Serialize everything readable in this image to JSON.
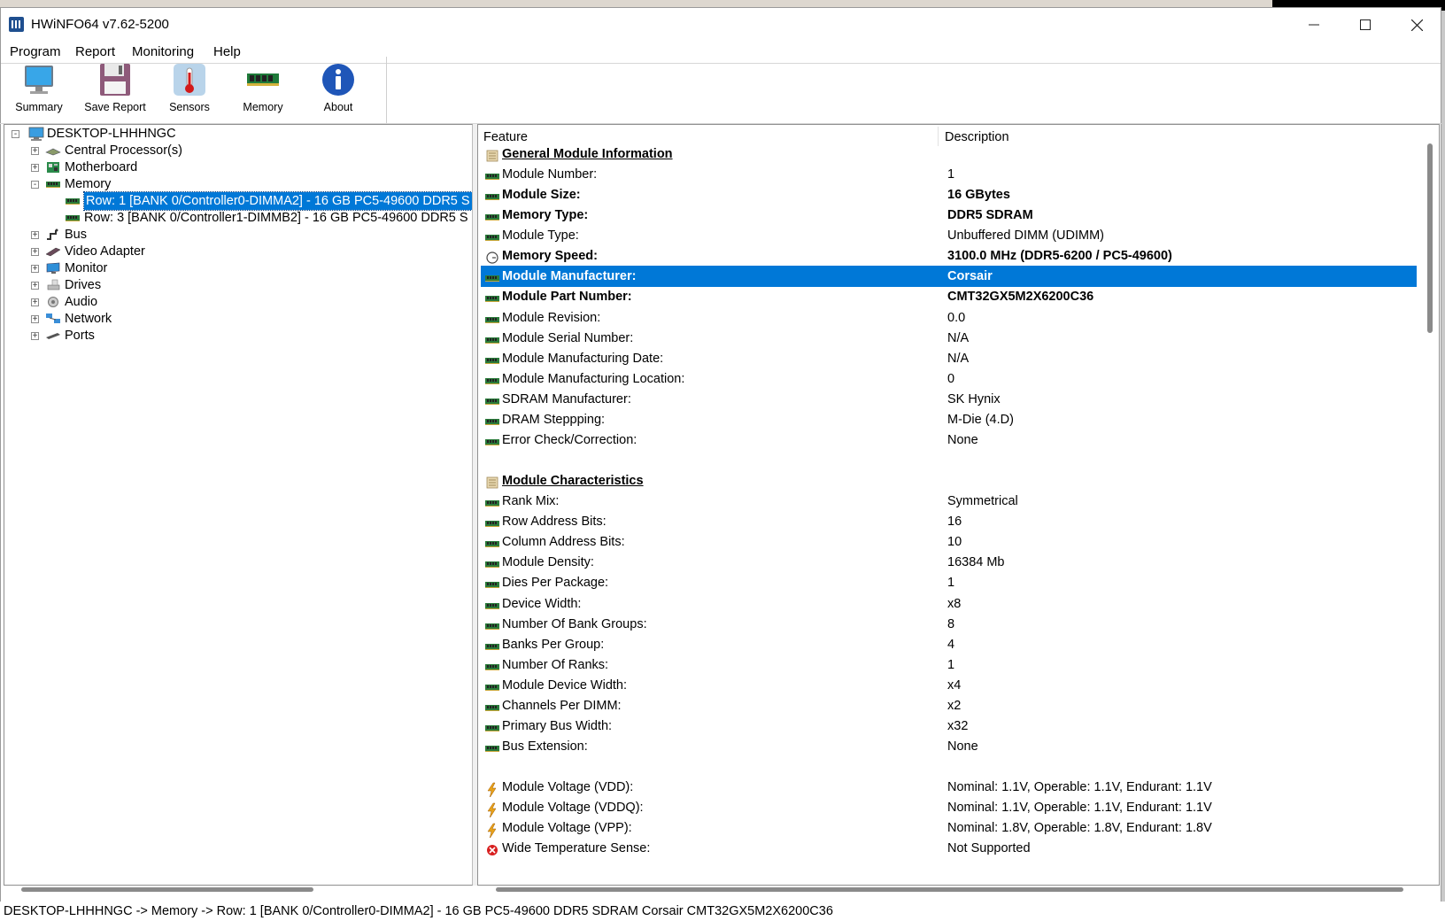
{
  "window": {
    "title": "HWiNFO64 v7.62-5200"
  },
  "menu": [
    "Program",
    "Report",
    "Monitoring",
    "Help"
  ],
  "toolbar": [
    {
      "label": "Summary",
      "icon": "monitor-icon"
    },
    {
      "label": "Save Report",
      "icon": "floppy-icon"
    },
    {
      "label": "Sensors",
      "icon": "thermometer-icon"
    },
    {
      "label": "Memory",
      "icon": "ram-icon"
    },
    {
      "label": "About",
      "icon": "info-icon"
    }
  ],
  "tree": {
    "root": "DESKTOP-LHHHNGC",
    "items": [
      {
        "label": "Central Processor(s)",
        "icon": "cpu-icon",
        "level": 1,
        "expand": "+"
      },
      {
        "label": "Motherboard",
        "icon": "motherboard-icon",
        "level": 1,
        "expand": "+"
      },
      {
        "label": "Memory",
        "icon": "ram-icon",
        "level": 1,
        "expand": "-"
      },
      {
        "label": "Row: 1 [BANK 0/Controller0-DIMMA2] - 16 GB PC5-49600 DDR5 S",
        "icon": "ram-icon",
        "level": 2,
        "selected": true
      },
      {
        "label": "Row: 3 [BANK 0/Controller1-DIMMB2] - 16 GB PC5-49600 DDR5 S",
        "icon": "ram-icon",
        "level": 2
      },
      {
        "label": "Bus",
        "icon": "bus-icon",
        "level": 1,
        "expand": "+"
      },
      {
        "label": "Video Adapter",
        "icon": "gpu-icon",
        "level": 1,
        "expand": "+"
      },
      {
        "label": "Monitor",
        "icon": "monitor-icon",
        "level": 1,
        "expand": "+"
      },
      {
        "label": "Drives",
        "icon": "drive-icon",
        "level": 1,
        "expand": "+"
      },
      {
        "label": "Audio",
        "icon": "speaker-icon",
        "level": 1,
        "expand": "+"
      },
      {
        "label": "Network",
        "icon": "network-icon",
        "level": 1,
        "expand": "+"
      },
      {
        "label": "Ports",
        "icon": "port-icon",
        "level": 1,
        "expand": "+"
      }
    ]
  },
  "details": {
    "headers": {
      "feature": "Feature",
      "description": "Description"
    },
    "rows": [
      {
        "type": "section",
        "feature": "General Module Information"
      },
      {
        "feature": "Module Number:",
        "desc": "1"
      },
      {
        "feature": "Module Size:",
        "desc": "16 GBytes",
        "bold": true
      },
      {
        "feature": "Memory Type:",
        "desc": "DDR5 SDRAM",
        "bold": true
      },
      {
        "feature": "Module Type:",
        "desc": "Unbuffered DIMM (UDIMM)"
      },
      {
        "feature": "Memory Speed:",
        "desc": "3100.0 MHz (DDR5-6200 / PC5-49600)",
        "bold": true,
        "icon": "clock-icon"
      },
      {
        "feature": "Module Manufacturer:",
        "desc": "Corsair",
        "bold": true,
        "selected": true
      },
      {
        "feature": "Module Part Number:",
        "desc": "CMT32GX5M2X6200C36",
        "bold": true
      },
      {
        "feature": "Module Revision:",
        "desc": "0.0"
      },
      {
        "feature": "Module Serial Number:",
        "desc": "N/A"
      },
      {
        "feature": "Module Manufacturing Date:",
        "desc": "N/A"
      },
      {
        "feature": "Module Manufacturing Location:",
        "desc": "0"
      },
      {
        "feature": "SDRAM Manufacturer:",
        "desc": "SK Hynix"
      },
      {
        "feature": "DRAM Steppping:",
        "desc": "M-Die (4.D)"
      },
      {
        "feature": "Error Check/Correction:",
        "desc": "None"
      },
      {
        "type": "blank"
      },
      {
        "type": "section",
        "feature": "Module Characteristics"
      },
      {
        "feature": "Rank Mix:",
        "desc": "Symmetrical"
      },
      {
        "feature": "Row Address Bits:",
        "desc": "16"
      },
      {
        "feature": "Column Address Bits:",
        "desc": "10"
      },
      {
        "feature": "Module Density:",
        "desc": "16384 Mb"
      },
      {
        "feature": "Dies Per Package:",
        "desc": "1"
      },
      {
        "feature": "Device Width:",
        "desc": "x8"
      },
      {
        "feature": "Number Of Bank Groups:",
        "desc": "8"
      },
      {
        "feature": "Banks Per Group:",
        "desc": "4"
      },
      {
        "feature": "Number Of Ranks:",
        "desc": "1"
      },
      {
        "feature": "Module Device Width:",
        "desc": "x4"
      },
      {
        "feature": "Channels Per DIMM:",
        "desc": "x2"
      },
      {
        "feature": "Primary Bus Width:",
        "desc": "x32"
      },
      {
        "feature": "Bus Extension:",
        "desc": "None"
      },
      {
        "type": "blank"
      },
      {
        "feature": "Module Voltage (VDD):",
        "desc": "Nominal: 1.1V, Operable: 1.1V, Endurant: 1.1V",
        "icon": "voltage-icon"
      },
      {
        "feature": "Module Voltage (VDDQ):",
        "desc": "Nominal: 1.1V, Operable: 1.1V, Endurant: 1.1V",
        "icon": "voltage-icon"
      },
      {
        "feature": "Module Voltage (VPP):",
        "desc": "Nominal: 1.8V, Operable: 1.8V, Endurant: 1.8V",
        "icon": "voltage-icon"
      },
      {
        "feature": "Wide Temperature Sense:",
        "desc": "Not Supported",
        "icon": "error-icon"
      }
    ]
  },
  "status": "DESKTOP-LHHHNGC -> Memory -> Row: 1 [BANK 0/Controller0-DIMMA2] - 16 GB PC5-49600 DDR5 SDRAM Corsair CMT32GX5M2X6200C36"
}
